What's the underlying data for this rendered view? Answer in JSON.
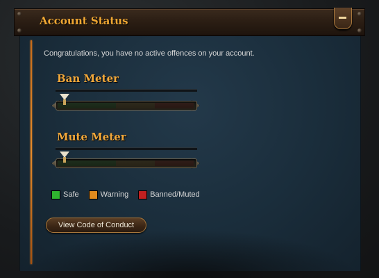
{
  "panel": {
    "title": "Account Status",
    "intro_text": "Congratulations, you have no active offences on your account."
  },
  "meters": [
    {
      "label": "Ban Meter",
      "level": 0
    },
    {
      "label": "Mute Meter",
      "level": 0
    }
  ],
  "legend": [
    {
      "label": "Safe",
      "color": "#2fb42f"
    },
    {
      "label": "Warning",
      "color": "#e08a1e"
    },
    {
      "label": "Banned/Muted",
      "color": "#c02020"
    }
  ],
  "actions": {
    "code_of_conduct_label": "View Code of Conduct"
  },
  "icons": {
    "collapse": "minus-icon",
    "pointer": "meter-pointer-icon"
  },
  "colors": {
    "accent_orange": "#f0a733",
    "panel_blue": "#1a2d3b"
  }
}
